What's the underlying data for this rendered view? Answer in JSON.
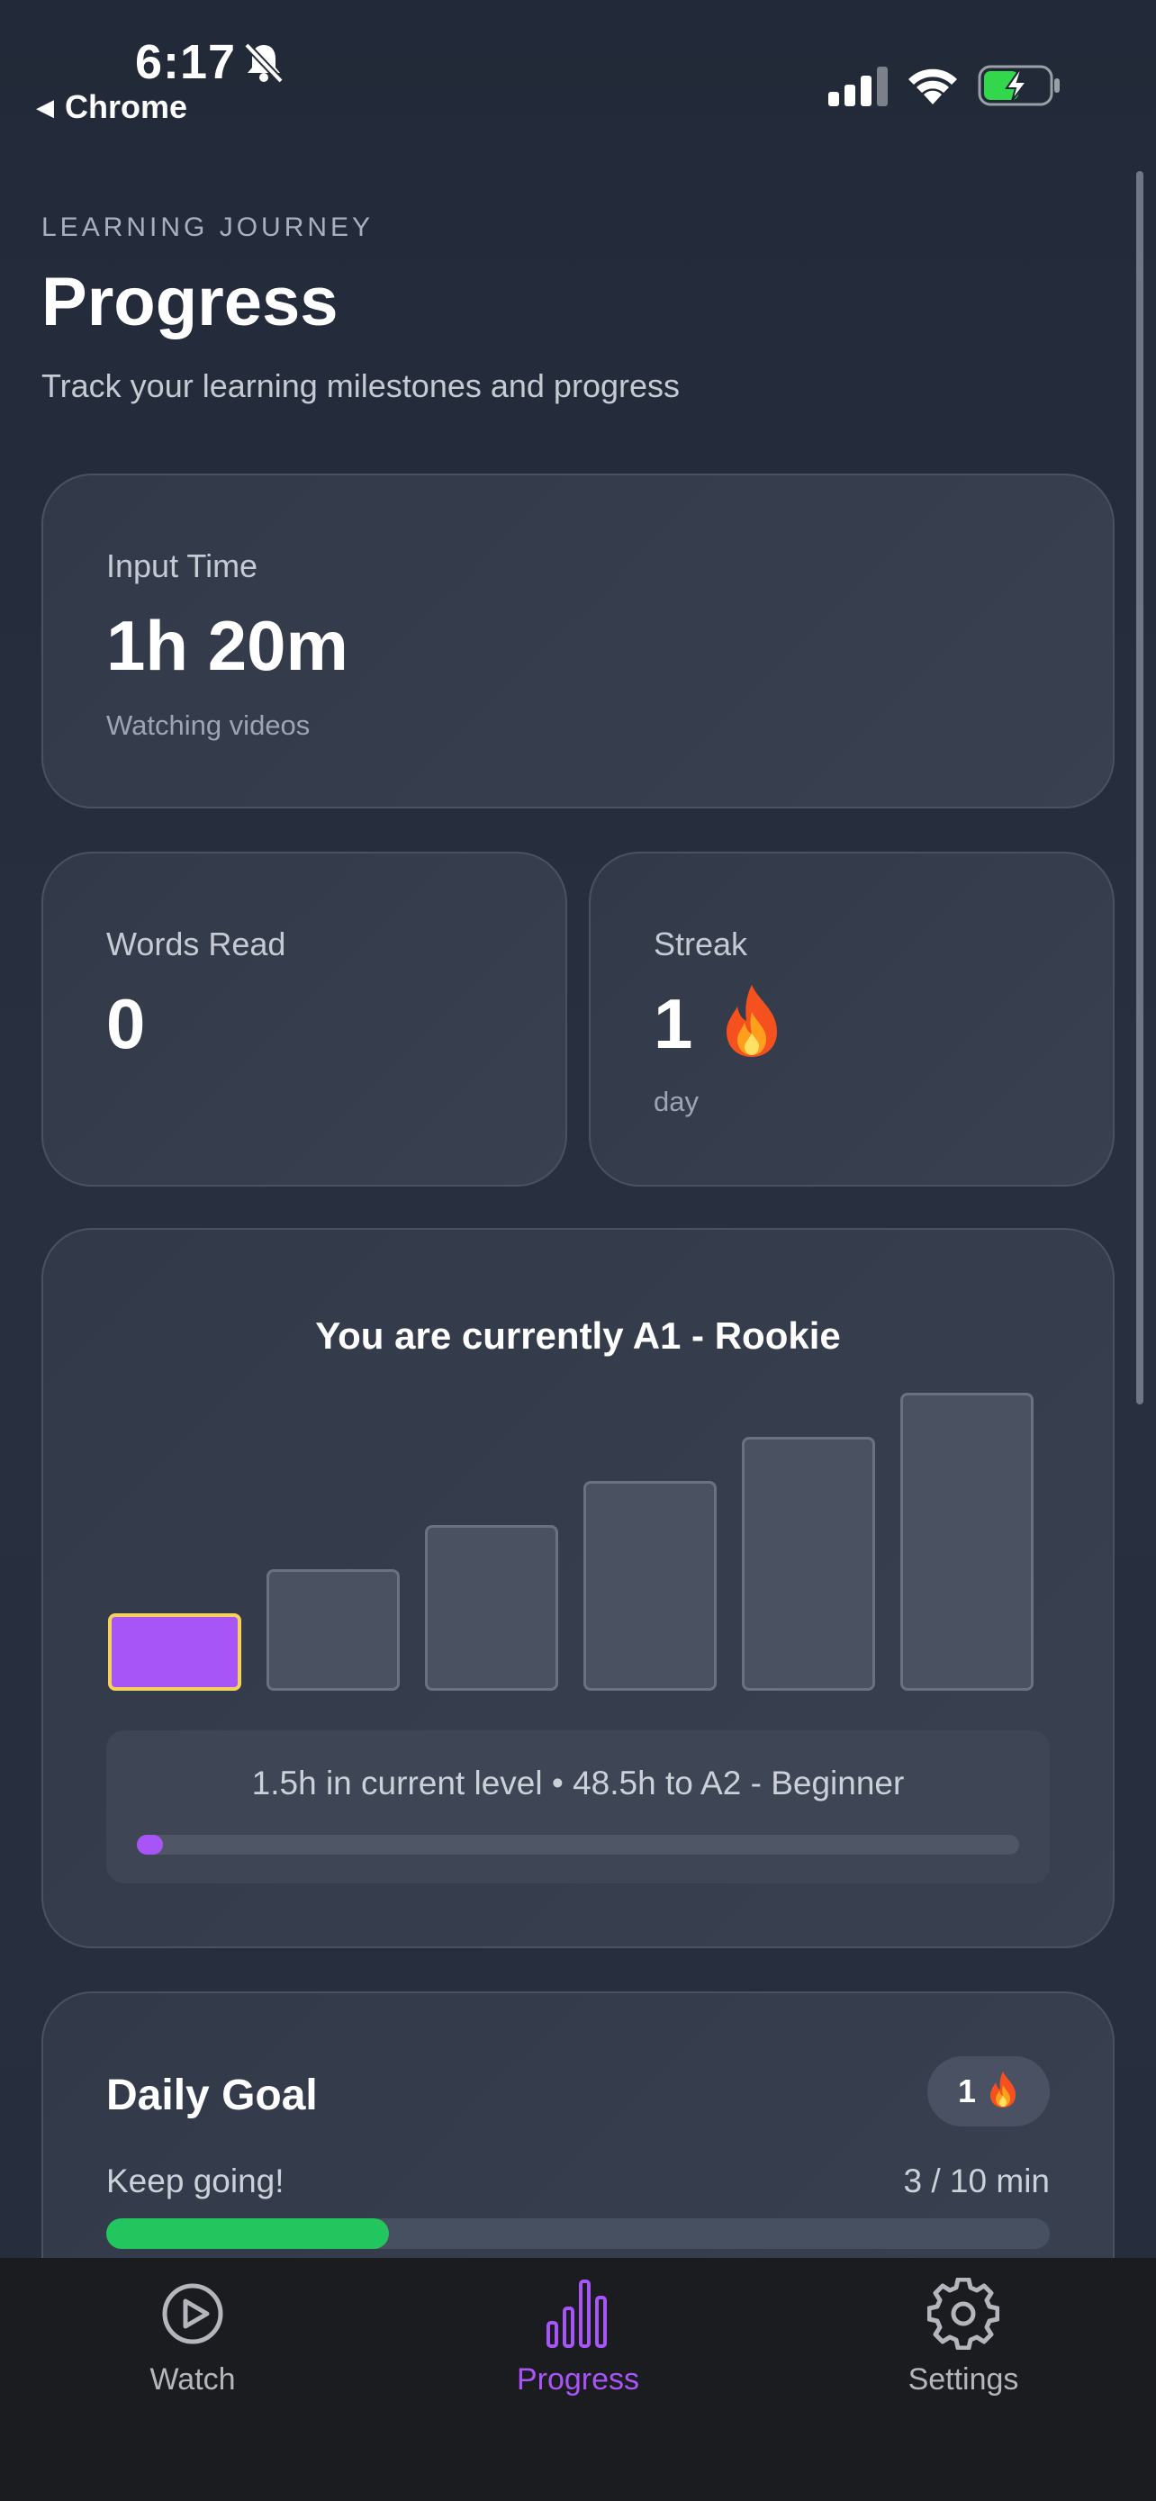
{
  "status_bar": {
    "time": "6:17",
    "back_app": "Chrome"
  },
  "header": {
    "eyebrow": "LEARNING JOURNEY",
    "title": "Progress",
    "subtitle": "Track your learning milestones and progress"
  },
  "input_time": {
    "label": "Input Time",
    "value": "1h 20m",
    "note": "Watching videos"
  },
  "words_read": {
    "label": "Words Read",
    "value": "0"
  },
  "streak": {
    "label": "Streak",
    "value": "1",
    "unit": "day",
    "icon": "fire-icon"
  },
  "level": {
    "title": "You are currently A1 - Rookie",
    "levels_count": 6,
    "current_index": 0,
    "info": "1.5h in current level • 48.5h to A2 - Beginner",
    "progress_fraction": 0.03,
    "accent_color": "#a855f7",
    "highlight_color": "#f5d35a"
  },
  "daily_goal": {
    "title": "Daily Goal",
    "badge_count": "1",
    "message": "Keep going!",
    "progress_text": "3 / 10 min",
    "progress_fraction": 0.3,
    "bar_color": "#22c55e"
  },
  "tabs": [
    {
      "label": "Watch",
      "icon": "play-circle-icon",
      "active": false
    },
    {
      "label": "Progress",
      "icon": "bar-chart-icon",
      "active": true
    },
    {
      "label": "Settings",
      "icon": "gear-icon",
      "active": false
    }
  ]
}
